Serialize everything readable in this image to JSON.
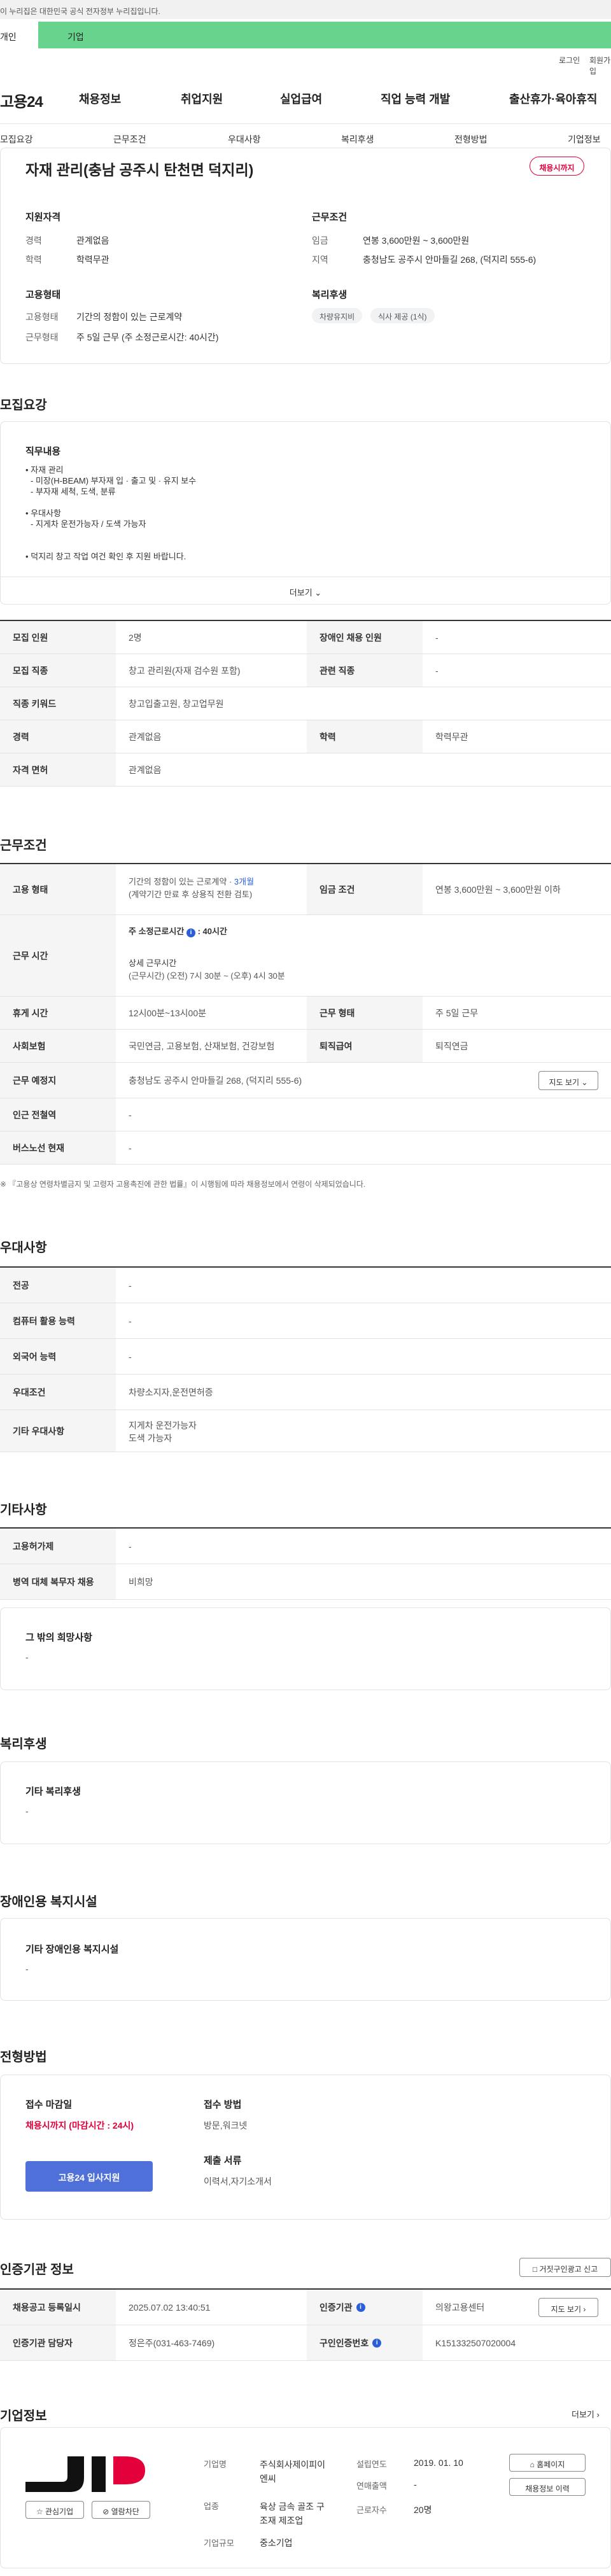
{
  "gov_banner": "이 누리집은 대한민국 공식 전자정부 누리집입니다.",
  "tabs": {
    "personal": "개인",
    "company": "기업"
  },
  "util": {
    "login": "로그인",
    "join": "회원가입"
  },
  "logo": "고용24",
  "gnb": [
    "채용정보",
    "취업지원",
    "실업급여",
    "직업 능력 개발",
    "출산휴가·육아휴직"
  ],
  "sub_nav": [
    "모집요강",
    "근무조건",
    "우대사항",
    "복리후생",
    "전형방법",
    "기업정보"
  ],
  "job": {
    "title": "자재 관리(충남 공주시 탄천면 덕지리)",
    "badge": "채용시까지",
    "qualification": {
      "heading": "지원자격",
      "career_label": "경력",
      "career_value": "관계없음",
      "edu_label": "학력",
      "edu_value": "학력무관"
    },
    "employment": {
      "heading": "고용형태",
      "type_label": "고용형태",
      "type_value": "기간의 정함이 있는 근로계약",
      "work_label": "근무형태",
      "work_value": "주 5일 근무 (주 소정근로시간: 40시간)"
    },
    "conditions": {
      "heading": "근무조건",
      "wage_label": "임금",
      "wage_value": "연봉 3,600만원 ~ 3,600만원",
      "area_label": "지역",
      "area_value": "충청남도 공주시 안마들길 268, (덕지리 555-6)"
    },
    "welfare": {
      "heading": "복리후생",
      "chips": [
        "차량유지비",
        "식사 제공 (1식)"
      ]
    }
  },
  "recruit": {
    "title": "모집요강",
    "duty_heading": "직무내용",
    "duty_lines": [
      "• 자재 관리",
      "- 미장(H-BEAM) 부자재 입 · 출고 및 · 유지 보수",
      "- 부자재 세척, 도색, 분류",
      "",
      "• 우대사항",
      "- 지게차 운전가능자 / 도색 가능자",
      "",
      "",
      "• 덕지리 창고 작업 여건 확인 후 지원 바랍니다."
    ],
    "more": "더보기",
    "rows": [
      {
        "k1": "모집 인원",
        "v1": "2명",
        "k2": "장애인 채용 인원",
        "v2": "-"
      },
      {
        "k1": "모집 직종",
        "v1": "창고 관리원(자재 검수원 포함)",
        "k2": "관련 직종",
        "v2": "-"
      },
      {
        "k1": "직종 키워드",
        "v1": "창고입출고원, 창고업무원"
      },
      {
        "k1": "경력",
        "v1": "관계없음",
        "k2": "학력",
        "v2": "학력무관"
      },
      {
        "k1": "자격 면허",
        "v1": "관계없음"
      }
    ]
  },
  "work": {
    "title": "근무조건",
    "emp_type_label": "고용 형태",
    "emp_type_value": "기간의 정함이 있는 근로계약 · ",
    "emp_type_months": "3개월",
    "emp_type_note": "(계약기간 만료 후 상용직 전환 검토)",
    "wage_label": "임금 조건",
    "wage_value": "연봉 3,600만원 ~ 3,600만원 이하",
    "hours_label": "근무 시간",
    "hours_weekly": "주 소정근로시간",
    "hours_weekly_value": ": 40시간",
    "hours_detail_heading": "상세 근무시간",
    "hours_detail": "(근무시간) (오전) 7시 30분 ~ (오후) 4시 30분",
    "rows": [
      {
        "k1": "휴게 시간",
        "v1": "12시00분~13시00분",
        "k2": "근무 형태",
        "v2": "주 5일 근무"
      },
      {
        "k1": "사회보험",
        "v1": "국민연금, 고용보험, 산재보험, 건강보험",
        "k2": "퇴직급여",
        "v2": "퇴직연금"
      },
      {
        "k1": "근무 예정지",
        "v1": "충청남도 공주시 안마들길 268, (덕지리 555-6)"
      },
      {
        "k1": "인근 전철역",
        "v1": "-"
      },
      {
        "k1": "버스노선 현재",
        "v1": "-"
      }
    ],
    "map_button": "지도 보기",
    "note": "※ 『고용상 연령차별금지 및 고령자 고용촉진에 관한 법률』이 시행됨에 따라 채용정보에서 연령이 삭제되었습니다."
  },
  "pref": {
    "title": "우대사항",
    "rows": [
      {
        "k": "전공",
        "v": "-"
      },
      {
        "k": "컴퓨터 활용 능력",
        "v": "-"
      },
      {
        "k": "외국어 능력",
        "v": "-"
      },
      {
        "k": "우대조건",
        "v": "차량소지자,운전면허증"
      },
      {
        "k": "기타 우대사항",
        "v": "지게차 운전가능자",
        "v2": "도색 가능자"
      }
    ]
  },
  "etc": {
    "title": "기타사항",
    "rows": [
      {
        "k": "고용허가제",
        "v": "-"
      },
      {
        "k": "병역 대체 복무자 채용",
        "v": "비희망"
      }
    ],
    "extra_heading": "그 밖의 희망사항",
    "extra_value": "-"
  },
  "welfare": {
    "title": "복리후생",
    "heading": "기타 복리후생",
    "value": "-"
  },
  "disability": {
    "title": "장애인용 복지시설",
    "heading": "기타 장애인용 복지시설",
    "value": "-"
  },
  "selection": {
    "title": "전형방법",
    "deadline_heading": "접수 마감일",
    "deadline_value": "채용시까지 (마감시간 : 24시)",
    "method_heading": "접수 방법",
    "method_value": "방문,워크넷",
    "docs_heading": "제출 서류",
    "docs_value": "이력서,자기소개서",
    "apply_button": "고용24 입사지원"
  },
  "cert": {
    "title": "인증기관 정보",
    "report_button": "거짓구인광고 신고",
    "rows": [
      {
        "k1": "채용공고 등록일시",
        "v1": "2025.07.02 13:40:51",
        "k2": "인증기관",
        "v2": "의왕고용센터"
      },
      {
        "k1": "인증기관 담당자",
        "v1": "정은주(031-463-7469)",
        "k2": "구인인증번호",
        "v2": "K151332507020004"
      }
    ],
    "map_button": "지도 보기"
  },
  "company": {
    "title": "기업정보",
    "more": "더보기",
    "interest_button": "관심기업",
    "block_button": "열람차단",
    "name_label": "기업명",
    "name_value_1": "주식회사제이피이",
    "name_value_2": "엔씨",
    "founded_label": "설립연도",
    "founded_value": "2019. 01. 10",
    "industry_label": "업종",
    "industry_value_1": "육상 금속 골조 구",
    "industry_value_2": "조재 제조업",
    "sales_label": "연매출액",
    "sales_value": "-",
    "employees_label": "근로자수",
    "employees_value": "20명",
    "size_label": "기업규모",
    "size_value": "중소기업",
    "homepage_button": "홈페이지",
    "history_button": "채용정보 이력"
  },
  "colors": {
    "tab_green": "#67d38d",
    "badge_red": "#e4003a",
    "apply_blue": "#4f6fd9"
  }
}
